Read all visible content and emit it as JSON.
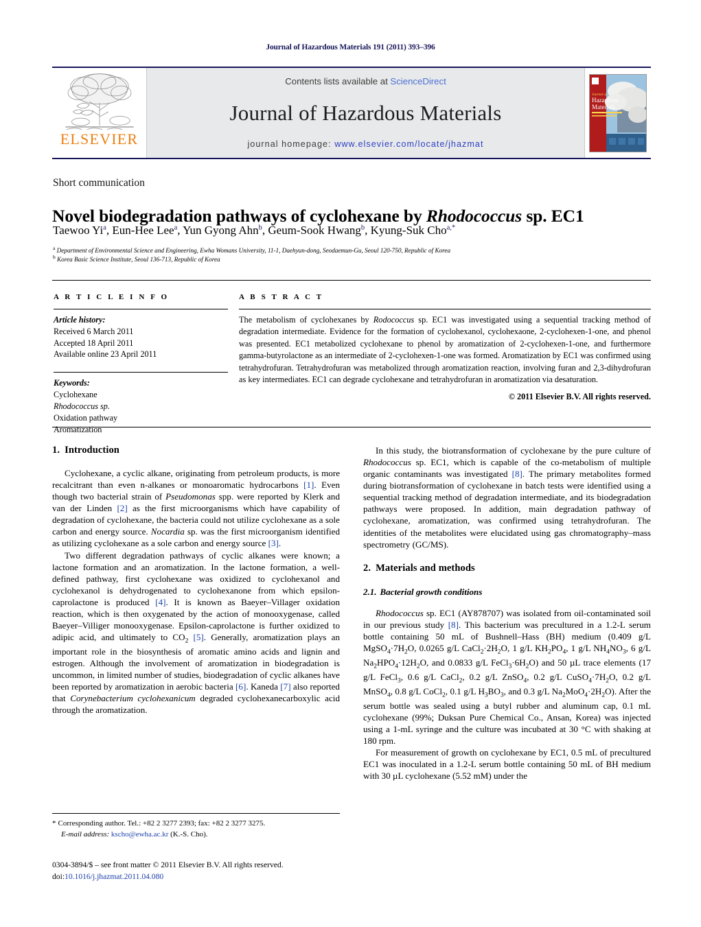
{
  "running_head": "Journal of Hazardous Materials 191 (2011) 393–396",
  "masthead": {
    "publisher_name": "ELSEVIER",
    "contents_prefix": "Contents lists available at ",
    "contents_link": "ScienceDirect",
    "journal_title": "Journal of Hazardous Materials",
    "homepage_prefix": "journal homepage:",
    "homepage_url": "www.elsevier.com/locate/jhazmat",
    "cover_title_line1": "Journal of",
    "cover_title_line2": "Hazardous",
    "cover_title_line3": "Materials",
    "accent_orange": "#ec8013",
    "link_blue": "#2b3fc4",
    "band_gray": "#e8e9ea",
    "rule_navy": "#16165a"
  },
  "article": {
    "type": "Short communication",
    "title_part1": "Novel biodegradation pathways of cyclohexane by ",
    "title_italic": "Rhodococcus",
    "title_part2": " sp. EC1",
    "authors": "Taewoo Yi",
    "authors_full": "Taewoo Yi ᵃ, Eun-Hee Lee ᵃ, Yun Gyong Ahn ᵇ, Geum-Sook Hwang ᵇ, Kyung-Suk Cho ᵃ,*",
    "author_list": [
      {
        "name": "Taewoo Yi",
        "sup": "a"
      },
      {
        "name": "Eun-Hee Lee",
        "sup": "a"
      },
      {
        "name": "Yun Gyong Ahn",
        "sup": "b"
      },
      {
        "name": "Geum-Sook Hwang",
        "sup": "b"
      },
      {
        "name": "Kyung-Suk Cho",
        "sup": "a,*"
      }
    ],
    "affiliation_a": "Department of Environmental Science and Engineering, Ewha Womans University, 11-1, Daehyun-dong, Seodaemun-Gu, Seoul 120-750, Republic of Korea",
    "affiliation_a_sup": "a",
    "affiliation_b": "Korea Basic Science Institute, Seoul 136-713, Republic of Korea",
    "affiliation_b_sup": "b"
  },
  "article_info": {
    "heading": "A R T I C L E   I N F O",
    "history_label": "Article history:",
    "received": "Received 6 March 2011",
    "accepted": "Accepted 18 April 2011",
    "available": "Available online 23 April 2011",
    "keywords_label": "Keywords:",
    "keywords": [
      "Cyclohexane",
      "Rhodococcus sp.",
      "Oxidation pathway",
      "Aromatization"
    ]
  },
  "abstract": {
    "heading": "A B S T R A C T",
    "text_1": "The metabolism of cyclohexanes by ",
    "text_italic_1": "Rodococcus",
    "text_2": " sp. EC1 was investigated using a sequential tracking method of degradation intermediate. Evidence for the formation of cyclohexanol, cyclohexaone, 2-cyclohexen-1-one, and phenol was presented. EC1 metabolized cyclohexane to phenol by aromatization of 2-cyclohexen-1-one, and furthermore gamma-butyrolactone as an intermediate of 2-cyclohexen-1-one was formed. Aromatization by EC1 was confirmed using tetrahydrofuran. Tetrahydrofuran was metabolized through aromatization reaction, involving furan and 2,3-dihydrofuran as key intermediates. EC1 can degrade cyclohexane and tetrahydrofuran in aromatization via desaturation.",
    "copyright": "© 2011 Elsevier B.V. All rights reserved."
  },
  "sections": {
    "introduction_num": "1.",
    "introduction_title": "Introduction",
    "intro_p1_a": "Cyclohexane, a cyclic alkane, originating from petroleum products, is more recalcitrant than even n-alkanes or monoaromatic hydrocarbons ",
    "intro_p1_ref1": "[1]",
    "intro_p1_b": ". Even though two bacterial strain of ",
    "intro_p1_it1": "Pseudomonas",
    "intro_p1_c": " spp. were reported by Klerk and van der Linden ",
    "intro_p1_ref2": "[2]",
    "intro_p1_d": " as the first microorganisms which have capability of degradation of cyclohexane, the bacteria could not utilize cyclohexane as a sole carbon and energy source. ",
    "intro_p1_it2": "Nocardia",
    "intro_p1_e": " sp. was the first microorganism identified as utilizing cyclohexane as a sole carbon and energy source ",
    "intro_p1_ref3": "[3]",
    "intro_p1_f": ".",
    "intro_p2_a": "Two different degradation pathways of cyclic alkanes were known; a lactone formation and an aromatization. In the lactone formation, a well-defined pathway, first cyclohexane was oxidized to cyclohexanol and cyclohexanol is dehydrogenated to cyclohexanone from which epsilon-caprolactone is produced ",
    "intro_p2_ref4": "[4]",
    "intro_p2_b": ". It is known as Baeyer–Villager oxidation reaction, which is then oxygenated by the action of monooxygenase, called Baeyer–Villiger monooxygenase. Epsilon-caprolactone is further oxidized to adipic acid, and ultimately to CO",
    "intro_p2_sub": "2",
    "intro_p2_c": " ",
    "intro_p2_ref5": "[5]",
    "intro_p2_d": ". Generally, aromatization plays an important role in the biosynthesis of aromatic amino acids and lignin and estrogen. Although the involvement of aromatization in biodegradation is uncommon, in limited number of studies, biodegradation of cyclic alkanes have been reported by aromatization in aerobic bacteria ",
    "intro_p2_ref6": "[6]",
    "intro_p2_e": ". Kaneda ",
    "intro_p2_ref7": "[7]",
    "intro_p2_f": " also reported that ",
    "intro_p2_it1": "Corynebacterium cyclohexanicum",
    "intro_p2_g": " degraded cyclohexanecarboxylic acid through the aromatization.",
    "right_p1_a": "In this study, the biotransformation of cyclohexane by the pure culture of ",
    "right_p1_it1": "Rhodococcus",
    "right_p1_b": " sp. EC1, which is capable of the co-metabolism of multiple organic contaminants was investigated ",
    "right_p1_ref8": "[8]",
    "right_p1_c": ". The primary metabolites formed during biotransformation of cyclohexane in batch tests were identified using a sequential tracking method of degradation intermediate, and its biodegradation pathways were proposed. In addition, main degradation pathway of cyclohexane, aromatization, was confirmed using tetrahydrofuran. The identities of the metabolites were elucidated using gas chromatography–mass spectrometry (GC/MS).",
    "materials_num": "2.",
    "materials_title": "Materials and methods",
    "bacterial_num": "2.1.",
    "bacterial_title": "Bacterial growth conditions",
    "bact_p1_it1": "Rhodococcus",
    "bact_p1_a": " sp. EC1 (AY878707) was isolated from oil-contaminated soil in our previous study ",
    "bact_p1_ref8": "[8]",
    "bact_p1_b": ". This bacterium was preculured in a 1.2-L serum bottle containing 50 mL of Bushnell–Hass (BH) medium (0.409 g/L MgSO",
    "bact_media": "(0.409 g/L MgSO4·7H2O, 0.0265 g/L CaCl2·2H2O, 1 g/L KH2PO4, 1 g/L NH4NO3, 6 g/L Na2HPO4·12H2O, and 0.0833 g/L FeCl3·6H2O) and 50 µL trace elements (17 g/L FeCl3, 0.6 g/L CaCl2, 0.2 g/L ZnSO4, 0.2 g/L CuSO4·7H2O, 0.2 g/L MnSO4, 0.8 g/L CoCl2, 0.1 g/L H3BO3, and 0.3 g/L Na2MoO4·2H2O)",
    "bact_p1_c": "After the serum bottle was sealed using a butyl rubber and aluminum cap, 0.1 mL cyclohexane (99%; Duksan Pure Chemical Co., Ansan, Korea) was injected using a 1-mL syringe and the culture was incubated at 30 °C with shaking at 180 rpm.",
    "bact_p2": "For measurement of growth on cyclohexane by EC1, 0.5 mL of precultured EC1 was inoculated in a 1.2-L serum bottle containing 50 mL of BH medium with 30 µL cyclohexane (5.52 mM) under the"
  },
  "footnote": {
    "star": "*",
    "corresponding": "Corresponding author. Tel.: +82 2 3277 2393; fax: +82 2 3277 3275.",
    "email_label": "E-mail address:",
    "email": "kscho@ewha.ac.kr",
    "email_owner": "(K.-S. Cho)."
  },
  "footer": {
    "issn_line": "0304-3894/$ – see front matter © 2011 Elsevier B.V. All rights reserved.",
    "doi_label": "doi:",
    "doi": "10.1016/j.jhazmat.2011.04.080"
  }
}
